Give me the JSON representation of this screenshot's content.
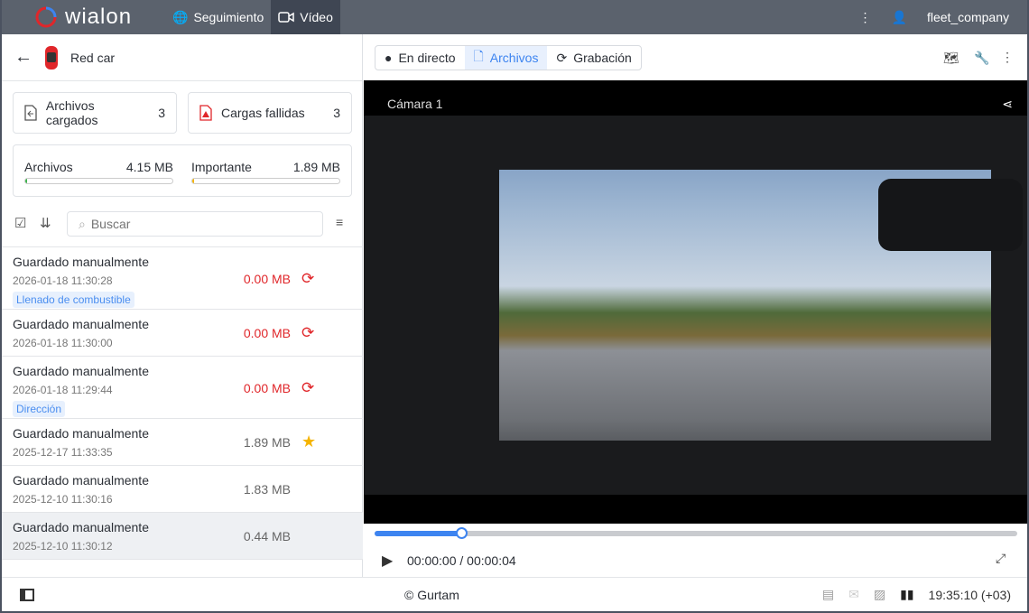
{
  "header": {
    "brand": "wialon",
    "tabs": [
      {
        "label": "Seguimiento",
        "icon": "globe-icon"
      },
      {
        "label": "Vídeo",
        "icon": "video-icon",
        "active": true
      }
    ],
    "user": "fleet_company"
  },
  "unit": {
    "name": "Red car"
  },
  "stats": {
    "uploaded_label": "Archivos cargados",
    "uploaded_count": "3",
    "failed_label": "Cargas fallidas",
    "failed_count": "3"
  },
  "storage": {
    "files_label": "Archivos",
    "files_value": "4.15 MB",
    "files_fill": 0.01,
    "important_label": "Importante",
    "important_value": "1.89 MB",
    "important_fill": 0.01
  },
  "search": {
    "placeholder": "Buscar"
  },
  "files": [
    {
      "title": "Guardado manualmente",
      "date": "2026-01-18 11:30:28",
      "size": "0.00 MB",
      "tag": "Llenado de combustible",
      "status": "failed"
    },
    {
      "title": "Guardado manualmente",
      "date": "2026-01-18 11:30:00",
      "size": "0.00 MB",
      "tag": null,
      "status": "failed"
    },
    {
      "title": "Guardado manualmente",
      "date": "2026-01-18 11:29:44",
      "size": "0.00 MB",
      "tag": "Dirección",
      "status": "failed"
    },
    {
      "title": "Guardado manualmente",
      "date": "2025-12-17 11:33:35",
      "size": "1.89 MB",
      "tag": null,
      "status": "important"
    },
    {
      "title": "Guardado manualmente",
      "date": "2025-12-10 11:30:16",
      "size": "1.83 MB",
      "tag": null,
      "status": "ok"
    },
    {
      "title": "Guardado manualmente",
      "date": "2025-12-10 11:30:12",
      "size": "0.44 MB",
      "tag": null,
      "status": "selected"
    }
  ],
  "modes": {
    "live": "En directo",
    "files": "Archivos",
    "recording": "Grabación",
    "active": "files"
  },
  "player": {
    "camera": "Cámara 1",
    "time": "00:00:00 / 00:00:04",
    "progress": 0.135
  },
  "footer": {
    "copyright": "© Gurtam",
    "clock": "19:35:10 (+03)"
  },
  "colors": {
    "accent": "#3d84f0",
    "error": "#e0262a",
    "star": "#f5b400"
  }
}
